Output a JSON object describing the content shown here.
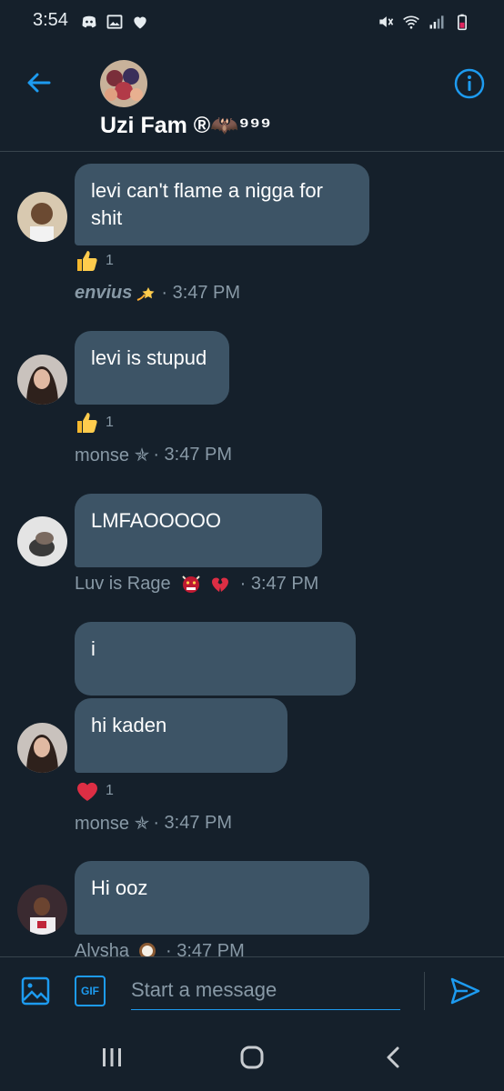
{
  "status_bar": {
    "time": "3:54",
    "left_icons": [
      "discord-icon",
      "image-icon",
      "heart-icon"
    ],
    "right_icons": [
      "mute-icon",
      "wifi-icon",
      "signal-icon",
      "battery-icon"
    ]
  },
  "header": {
    "title": "Uzi Fam ®🦇⁹⁹⁹",
    "accent_color": "#1d9bf0"
  },
  "messages": [
    {
      "text": "levi can't flame a nigga for shit",
      "reaction": {
        "emoji": "thumbs-up",
        "count": "1"
      },
      "sender": "envius",
      "sender_emoji": "dizzy-star",
      "time": "· 3:47 PM"
    },
    {
      "text": "levi is stupud",
      "reaction": {
        "emoji": "thumbs-up",
        "count": "1"
      },
      "sender": "monse ✯",
      "time": "· 3:47 PM"
    },
    {
      "text": "LMFAOOOOO",
      "sender": "Luv is Rage",
      "time": "· 3:47 PM"
    },
    {
      "text": "i"
    },
    {
      "text": "hi kaden",
      "reaction": {
        "emoji": "red-heart",
        "count": "1"
      },
      "sender": "monse ✯",
      "time": "· 3:47 PM"
    },
    {
      "text": "Hi ooz",
      "sender": "Alysha",
      "time": "· 3:47 PM"
    }
  ],
  "composer": {
    "placeholder": "Start a message",
    "gif_label": "GIF"
  },
  "colors": {
    "background": "#15202b",
    "bubble": "#3d5466",
    "muted_text": "#8899a6",
    "accent": "#1d9bf0"
  }
}
